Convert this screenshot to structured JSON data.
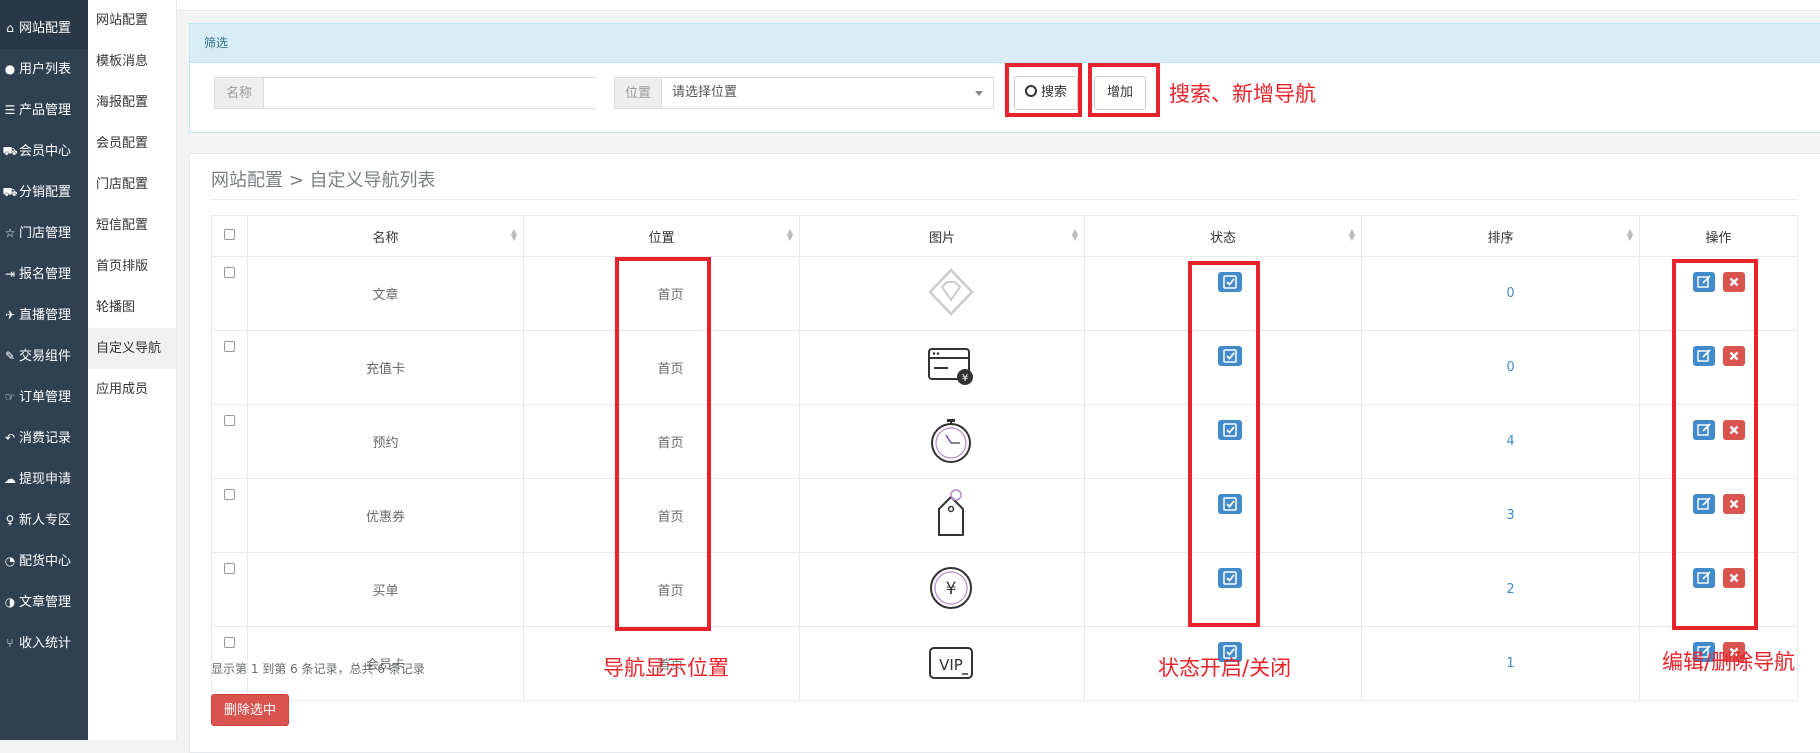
{
  "sidebar": {
    "items": [
      {
        "icon": "home-icon",
        "glyph": "⌂",
        "label": "网站配置"
      },
      {
        "icon": "user-icon",
        "glyph": "●",
        "label": "用户列表"
      },
      {
        "icon": "list-icon",
        "glyph": "☰",
        "label": "产品管理"
      },
      {
        "icon": "cart-icon",
        "glyph": "⛟",
        "label": "会员中心"
      },
      {
        "icon": "cart-icon",
        "glyph": "⛟",
        "label": "分销配置"
      },
      {
        "icon": "star-icon",
        "glyph": "☆",
        "label": "门店管理"
      },
      {
        "icon": "signin-icon",
        "glyph": "⇥",
        "label": "报名管理"
      },
      {
        "icon": "plane-icon",
        "glyph": "✈",
        "label": "直播管理"
      },
      {
        "icon": "eraser-icon",
        "glyph": "✎",
        "label": "交易组件"
      },
      {
        "icon": "hand-icon",
        "glyph": "☞",
        "label": "订单管理"
      },
      {
        "icon": "reply-icon",
        "glyph": "↶",
        "label": "消费记录"
      },
      {
        "icon": "chat-icon",
        "glyph": "☁",
        "label": "提现申请"
      },
      {
        "icon": "pin-icon",
        "glyph": "♀",
        "label": "新人专区"
      },
      {
        "icon": "pie-chart-icon",
        "glyph": "◔",
        "label": "配货中心"
      },
      {
        "icon": "contrast-icon",
        "glyph": "◑",
        "label": "文章管理"
      },
      {
        "icon": "fork-icon",
        "glyph": "⑂",
        "label": "收入统计"
      }
    ]
  },
  "submenu": {
    "items": [
      "网站配置",
      "模板消息",
      "海报配置",
      "会员配置",
      "门店配置",
      "短信配置",
      "首页排版",
      "轮播图",
      "自定义导航",
      "应用成员"
    ]
  },
  "filter": {
    "title": "筛选",
    "name_label": "名称",
    "name_value": "",
    "position_label": "位置",
    "position_selected": "请选择位置",
    "search_label": "搜索",
    "add_label": "增加"
  },
  "breadcrumb": "网站配置 > 自定义导航列表",
  "table": {
    "headers": [
      "名称",
      "位置",
      "图片",
      "状态",
      "排序",
      "操作"
    ],
    "rows": [
      {
        "name": "文章",
        "position": "首页",
        "image": "diamond-icon",
        "rank": "0"
      },
      {
        "name": "充值卡",
        "position": "首页",
        "image": "recharge-card-icon",
        "rank": "0"
      },
      {
        "name": "预约",
        "position": "首页",
        "image": "stopwatch-icon",
        "rank": "4"
      },
      {
        "name": "优惠券",
        "position": "首页",
        "image": "coupon-tag-icon",
        "rank": "3"
      },
      {
        "name": "买单",
        "position": "首页",
        "image": "yuan-coin-icon",
        "rank": "2"
      },
      {
        "name": "会员卡",
        "position": "首页",
        "image": "vip-card-icon",
        "rank": "1"
      }
    ]
  },
  "footer": {
    "info": "显示第 1 到第 6 条记录，总共 6 条记录",
    "delete_selected": "删除选中"
  },
  "annotations": {
    "search_add": "搜索、新增导航",
    "position": "导航显示位置",
    "status": "状态开启/关闭",
    "operations": "编辑/删除导航"
  },
  "colors": {
    "sidebar": "#2f4050",
    "primary": "#428bca",
    "danger": "#d9534f",
    "annotation": "#e8232b",
    "filter_head": "#d9edf7"
  }
}
